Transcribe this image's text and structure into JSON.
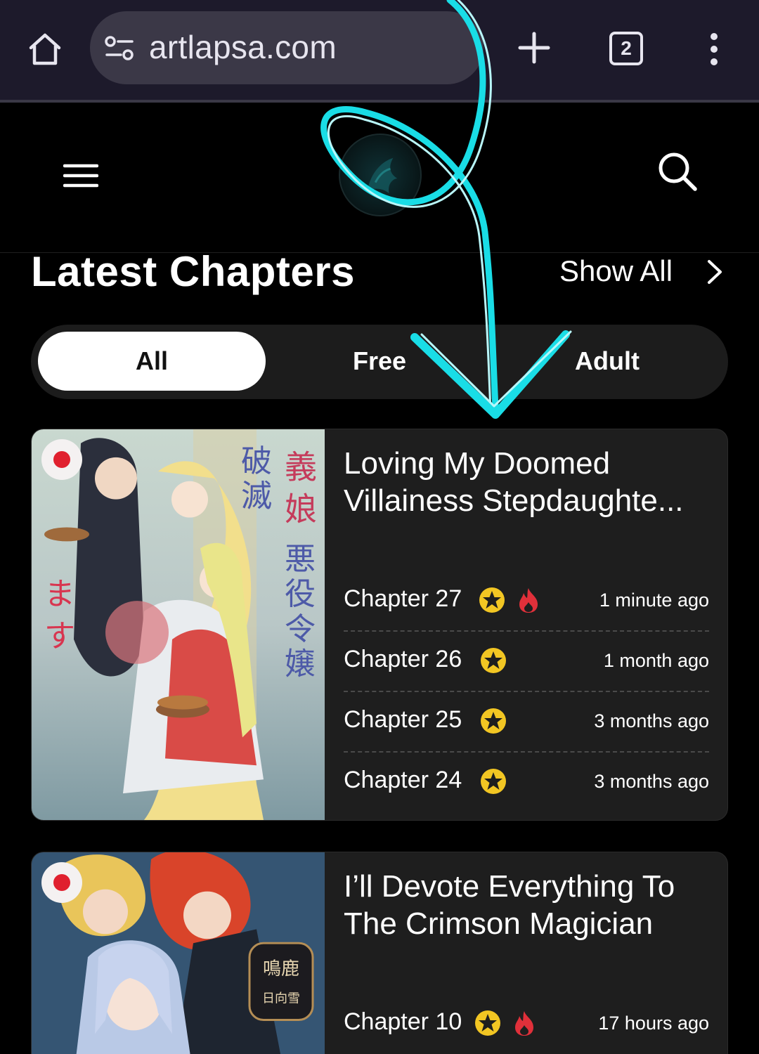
{
  "browser": {
    "url": "artlapsa.com",
    "tab_count": "2"
  },
  "header": {
    "logo_name": "site-logo"
  },
  "section": {
    "title": "Latest Chapters",
    "show_all": "Show All"
  },
  "filters": [
    {
      "label": "All",
      "active": true
    },
    {
      "label": "Free",
      "active": false
    },
    {
      "label": "Adult",
      "active": false
    }
  ],
  "cards": [
    {
      "title": "Loving My Doomed Villainess Stepdaughte...",
      "title_line1": "Loving My Doomed",
      "title_line2": "Villainess Stepdaughte...",
      "chapters": [
        {
          "label": "Chapter 27",
          "time": "1 minute ago",
          "hot": true
        },
        {
          "label": "Chapter 26",
          "time": "1 month ago",
          "hot": false
        },
        {
          "label": "Chapter 25",
          "time": "3 months ago",
          "hot": false
        },
        {
          "label": "Chapter 24",
          "time": "3 months ago",
          "hot": false
        }
      ]
    },
    {
      "title_line1": "I’ll Devote Everything To",
      "title_line2": "The Crimson Magician",
      "chapters": [
        {
          "label": "Chapter 10",
          "time": "17 hours ago",
          "hot": true
        }
      ]
    }
  ],
  "colors": {
    "browser_bar": "#1d1a2b",
    "url_pill": "#3b3847",
    "card_bg": "#1e1e1e",
    "star": "#f2c623",
    "fire": "#e0303a",
    "annotation": "#19dde6"
  }
}
